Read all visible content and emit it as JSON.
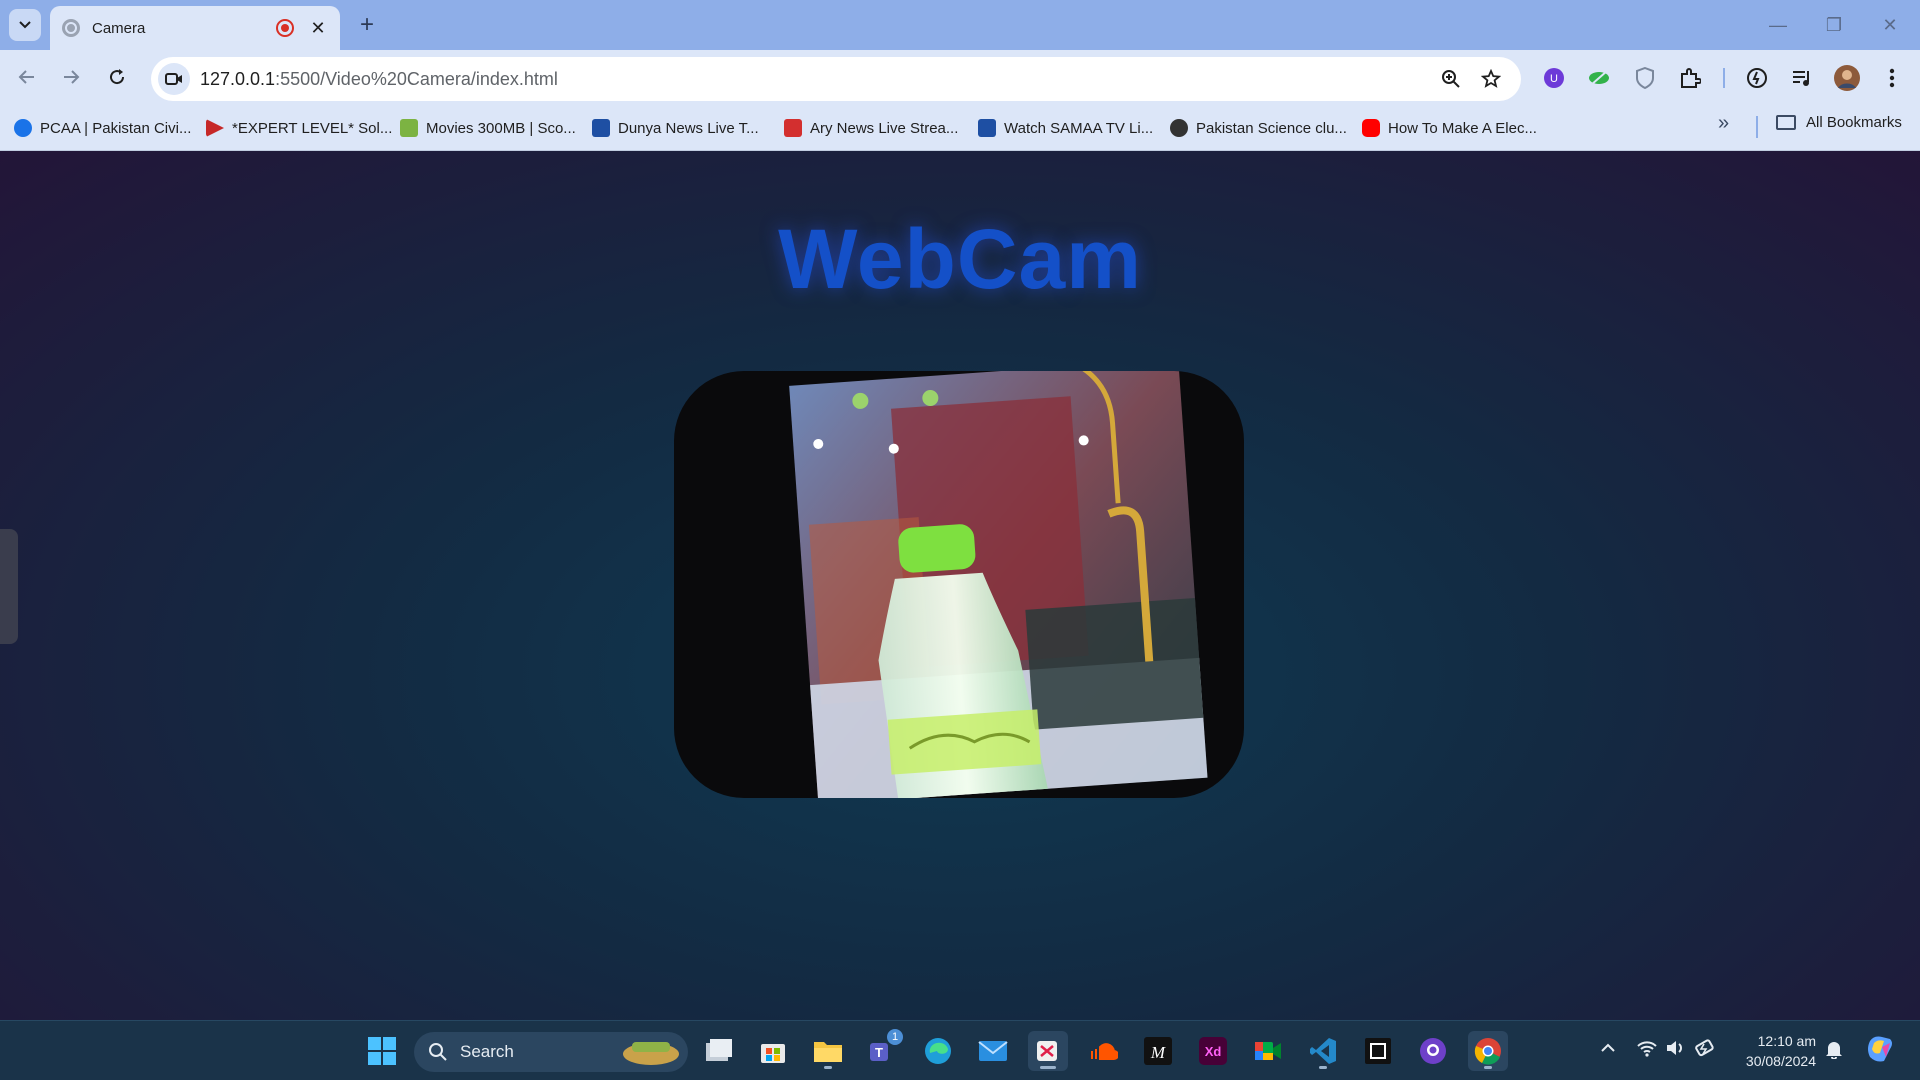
{
  "browser": {
    "tab": {
      "title": "Camera"
    },
    "address": {
      "host": "127.0.0.1",
      "rest": ":5500/Video%20Camera/index.html"
    },
    "bookmarks": [
      {
        "label": "PCAA | Pakistan Civi...",
        "icon_color": "#1a73e8"
      },
      {
        "label": "*EXPERT LEVEL* Sol...",
        "icon_color": "#c62828"
      },
      {
        "label": "Movies 300MB | Sco...",
        "icon_color": "#7cb342"
      },
      {
        "label": "Dunya News Live T...",
        "icon_color": "#1e4fa3"
      },
      {
        "label": "Ary News Live Strea...",
        "icon_color": "#d32f2f"
      },
      {
        "label": "Watch SAMAA TV Li...",
        "icon_color": "#1e4fa3"
      },
      {
        "label": "Pakistan Science clu...",
        "icon_color": "#333333"
      },
      {
        "label": "How To Make A Elec...",
        "icon_color": "#ff0000"
      }
    ],
    "all_bookmarks_label": "All Bookmarks"
  },
  "page": {
    "heading": "WebCam",
    "heading_color": "#1450c8",
    "side_handle_icon": "chevron-left-icon"
  },
  "taskbar": {
    "search_label": "Search",
    "teams_badge": "1",
    "time": "12:10 am",
    "date": "30/08/2024"
  }
}
